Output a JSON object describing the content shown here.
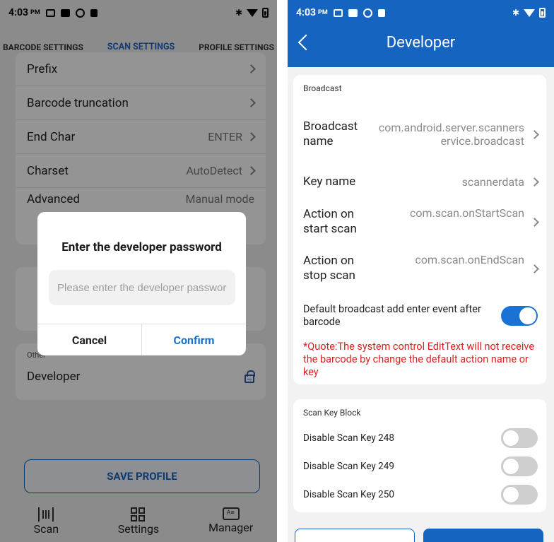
{
  "left": {
    "status": {
      "time": "4:03",
      "ampm": "PM"
    },
    "tabs": [
      "BARCODE SETTINGS",
      "SCAN SETTINGS",
      "PROFILE SETTINGS"
    ],
    "rows": [
      {
        "label": "Prefix",
        "value": ""
      },
      {
        "label": "Barcode truncation",
        "value": ""
      },
      {
        "label": "End Char",
        "value": "ENTER"
      },
      {
        "label": "Charset",
        "value": "AutoDetect"
      },
      {
        "label": "Advanced",
        "value": "Manual mode"
      }
    ],
    "other_section": "Other",
    "developer": "Developer",
    "save_button": "SAVE PROFILE",
    "nav": [
      "Scan",
      "Settings",
      "Manager"
    ],
    "dialog": {
      "title": "Enter the developer password",
      "placeholder": "Please enter the developer password",
      "cancel": "Cancel",
      "confirm": "Confirm"
    }
  },
  "right": {
    "status": {
      "time": "4:03",
      "ampm": "PM"
    },
    "title": "Developer",
    "broadcast_section": "Broadcast",
    "rows": [
      {
        "key": "Broadcast name",
        "value": "com.android.server.scannerservice.broadcast"
      },
      {
        "key": "Key name",
        "value": "scannerdata"
      },
      {
        "key": "Action on start scan",
        "value": "com.scan.onStartScan"
      },
      {
        "key": "Action on stop scan",
        "value": "com.scan.onEndScan"
      }
    ],
    "default_enter": "Default broadcast add enter event after barcode",
    "default_enter_on": true,
    "warning": "*Quote:The system control EditText will not receive the barcode by change the default action name or key",
    "scan_key_section": "Scan Key Block",
    "keys": [
      {
        "label": "Disable Scan Key 248",
        "on": false
      },
      {
        "label": "Disable Scan Key 249",
        "on": false
      },
      {
        "label": "Disable Scan Key 250",
        "on": false
      }
    ]
  }
}
